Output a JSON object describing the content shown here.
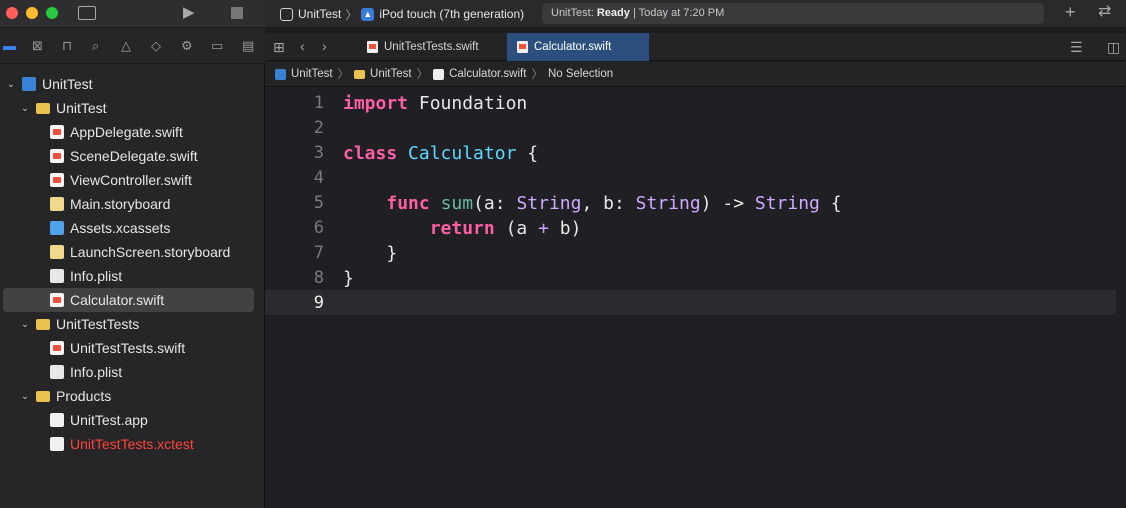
{
  "window": {
    "title": "UnitTest"
  },
  "toolbar": {
    "scheme": "UnitTest",
    "destination": "iPod touch (7th generation)",
    "status_app": "UnitTest:",
    "status_state": "Ready",
    "status_time": "Today at 7:20 PM",
    "icons": [
      "sidebar-toggle-icon",
      "run-icon",
      "stop-icon",
      "add-icon",
      "code-review-icon"
    ]
  },
  "navigator": {
    "icons": [
      "project-navigator-icon",
      "source-control-icon",
      "symbol-navigator-icon",
      "find-icon",
      "issue-icon",
      "test-icon",
      "debug-icon",
      "breakpoint-icon",
      "report-icon"
    ],
    "tree": [
      {
        "label": "UnitTest",
        "type": "project",
        "depth": 0,
        "expanded": true
      },
      {
        "label": "UnitTest",
        "type": "folder",
        "depth": 1,
        "expanded": true
      },
      {
        "label": "AppDelegate.swift",
        "type": "swift",
        "depth": 2
      },
      {
        "label": "SceneDelegate.swift",
        "type": "swift",
        "depth": 2
      },
      {
        "label": "ViewController.swift",
        "type": "swift",
        "depth": 2
      },
      {
        "label": "Main.storyboard",
        "type": "storyboard",
        "depth": 2
      },
      {
        "label": "Assets.xcassets",
        "type": "assets",
        "depth": 2
      },
      {
        "label": "LaunchScreen.storyboard",
        "type": "storyboard",
        "depth": 2
      },
      {
        "label": "Info.plist",
        "type": "plist",
        "depth": 2
      },
      {
        "label": "Calculator.swift",
        "type": "swift",
        "depth": 2,
        "selected": true
      },
      {
        "label": "UnitTestTests",
        "type": "folder",
        "depth": 1,
        "expanded": true
      },
      {
        "label": "UnitTestTests.swift",
        "type": "swift",
        "depth": 2
      },
      {
        "label": "Info.plist",
        "type": "plist",
        "depth": 2
      },
      {
        "label": "Products",
        "type": "products",
        "depth": 1,
        "expanded": true
      },
      {
        "label": "UnitTest.app",
        "type": "app",
        "depth": 2
      },
      {
        "label": "UnitTestTests.xctest",
        "type": "test",
        "depth": 2,
        "missing": true
      }
    ]
  },
  "editor": {
    "tabs": [
      {
        "label": "UnitTestTests.swift",
        "active": false
      },
      {
        "label": "Calculator.swift",
        "active": true
      }
    ],
    "breadcrumb": [
      "UnitTest",
      "UnitTest",
      "Calculator.swift",
      "No Selection"
    ],
    "current_line": "9",
    "lines": [
      {
        "n": "1",
        "tokens": [
          {
            "t": "import",
            "c": "kw"
          },
          {
            "t": " Foundation",
            "c": ""
          }
        ]
      },
      {
        "n": "2",
        "tokens": []
      },
      {
        "n": "3",
        "tokens": [
          {
            "t": "class",
            "c": "kw"
          },
          {
            "t": " ",
            "c": ""
          },
          {
            "t": "Calculator",
            "c": "ty"
          },
          {
            "t": " {",
            "c": ""
          }
        ]
      },
      {
        "n": "4",
        "tokens": []
      },
      {
        "n": "5",
        "tokens": [
          {
            "t": "    ",
            "c": ""
          },
          {
            "t": "func",
            "c": "kw"
          },
          {
            "t": " ",
            "c": ""
          },
          {
            "t": "sum",
            "c": "fn"
          },
          {
            "t": "(a: ",
            "c": ""
          },
          {
            "t": "String",
            "c": "tyb"
          },
          {
            "t": ", b: ",
            "c": ""
          },
          {
            "t": "String",
            "c": "tyb"
          },
          {
            "t": ") -> ",
            "c": ""
          },
          {
            "t": "String",
            "c": "tyb"
          },
          {
            "t": " {",
            "c": ""
          }
        ]
      },
      {
        "n": "6",
        "tokens": [
          {
            "t": "        ",
            "c": ""
          },
          {
            "t": "return",
            "c": "kw"
          },
          {
            "t": " (a ",
            "c": ""
          },
          {
            "t": "+",
            "c": "op"
          },
          {
            "t": " b)",
            "c": ""
          }
        ]
      },
      {
        "n": "7",
        "tokens": [
          {
            "t": "    }",
            "c": ""
          }
        ]
      },
      {
        "n": "8",
        "tokens": [
          {
            "t": "}",
            "c": ""
          }
        ]
      },
      {
        "n": "9",
        "tokens": []
      }
    ]
  },
  "colors": {
    "keyword": "#fc5fa3",
    "type": "#5dd8ff",
    "function": "#67b7a4",
    "stdlib_type": "#d0a8ff",
    "selection": "#2d4f7d",
    "missing_file": "#ff453a"
  }
}
